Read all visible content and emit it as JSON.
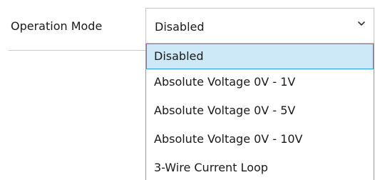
{
  "form": {
    "operation_mode_label": "Operation Mode",
    "select": {
      "value": "Disabled",
      "chevron_icon": "chevron-down-icon"
    },
    "options": [
      {
        "label": "Disabled",
        "selected": true
      },
      {
        "label": "Absolute Voltage 0V - 1V",
        "selected": false
      },
      {
        "label": "Absolute Voltage 0V - 5V",
        "selected": false
      },
      {
        "label": "Absolute Voltage 0V - 10V",
        "selected": false
      },
      {
        "label": "3-Wire Current Loop",
        "selected": false
      }
    ]
  },
  "colors": {
    "selection_background": "#cde8f6",
    "selection_border": "#26a0da"
  }
}
